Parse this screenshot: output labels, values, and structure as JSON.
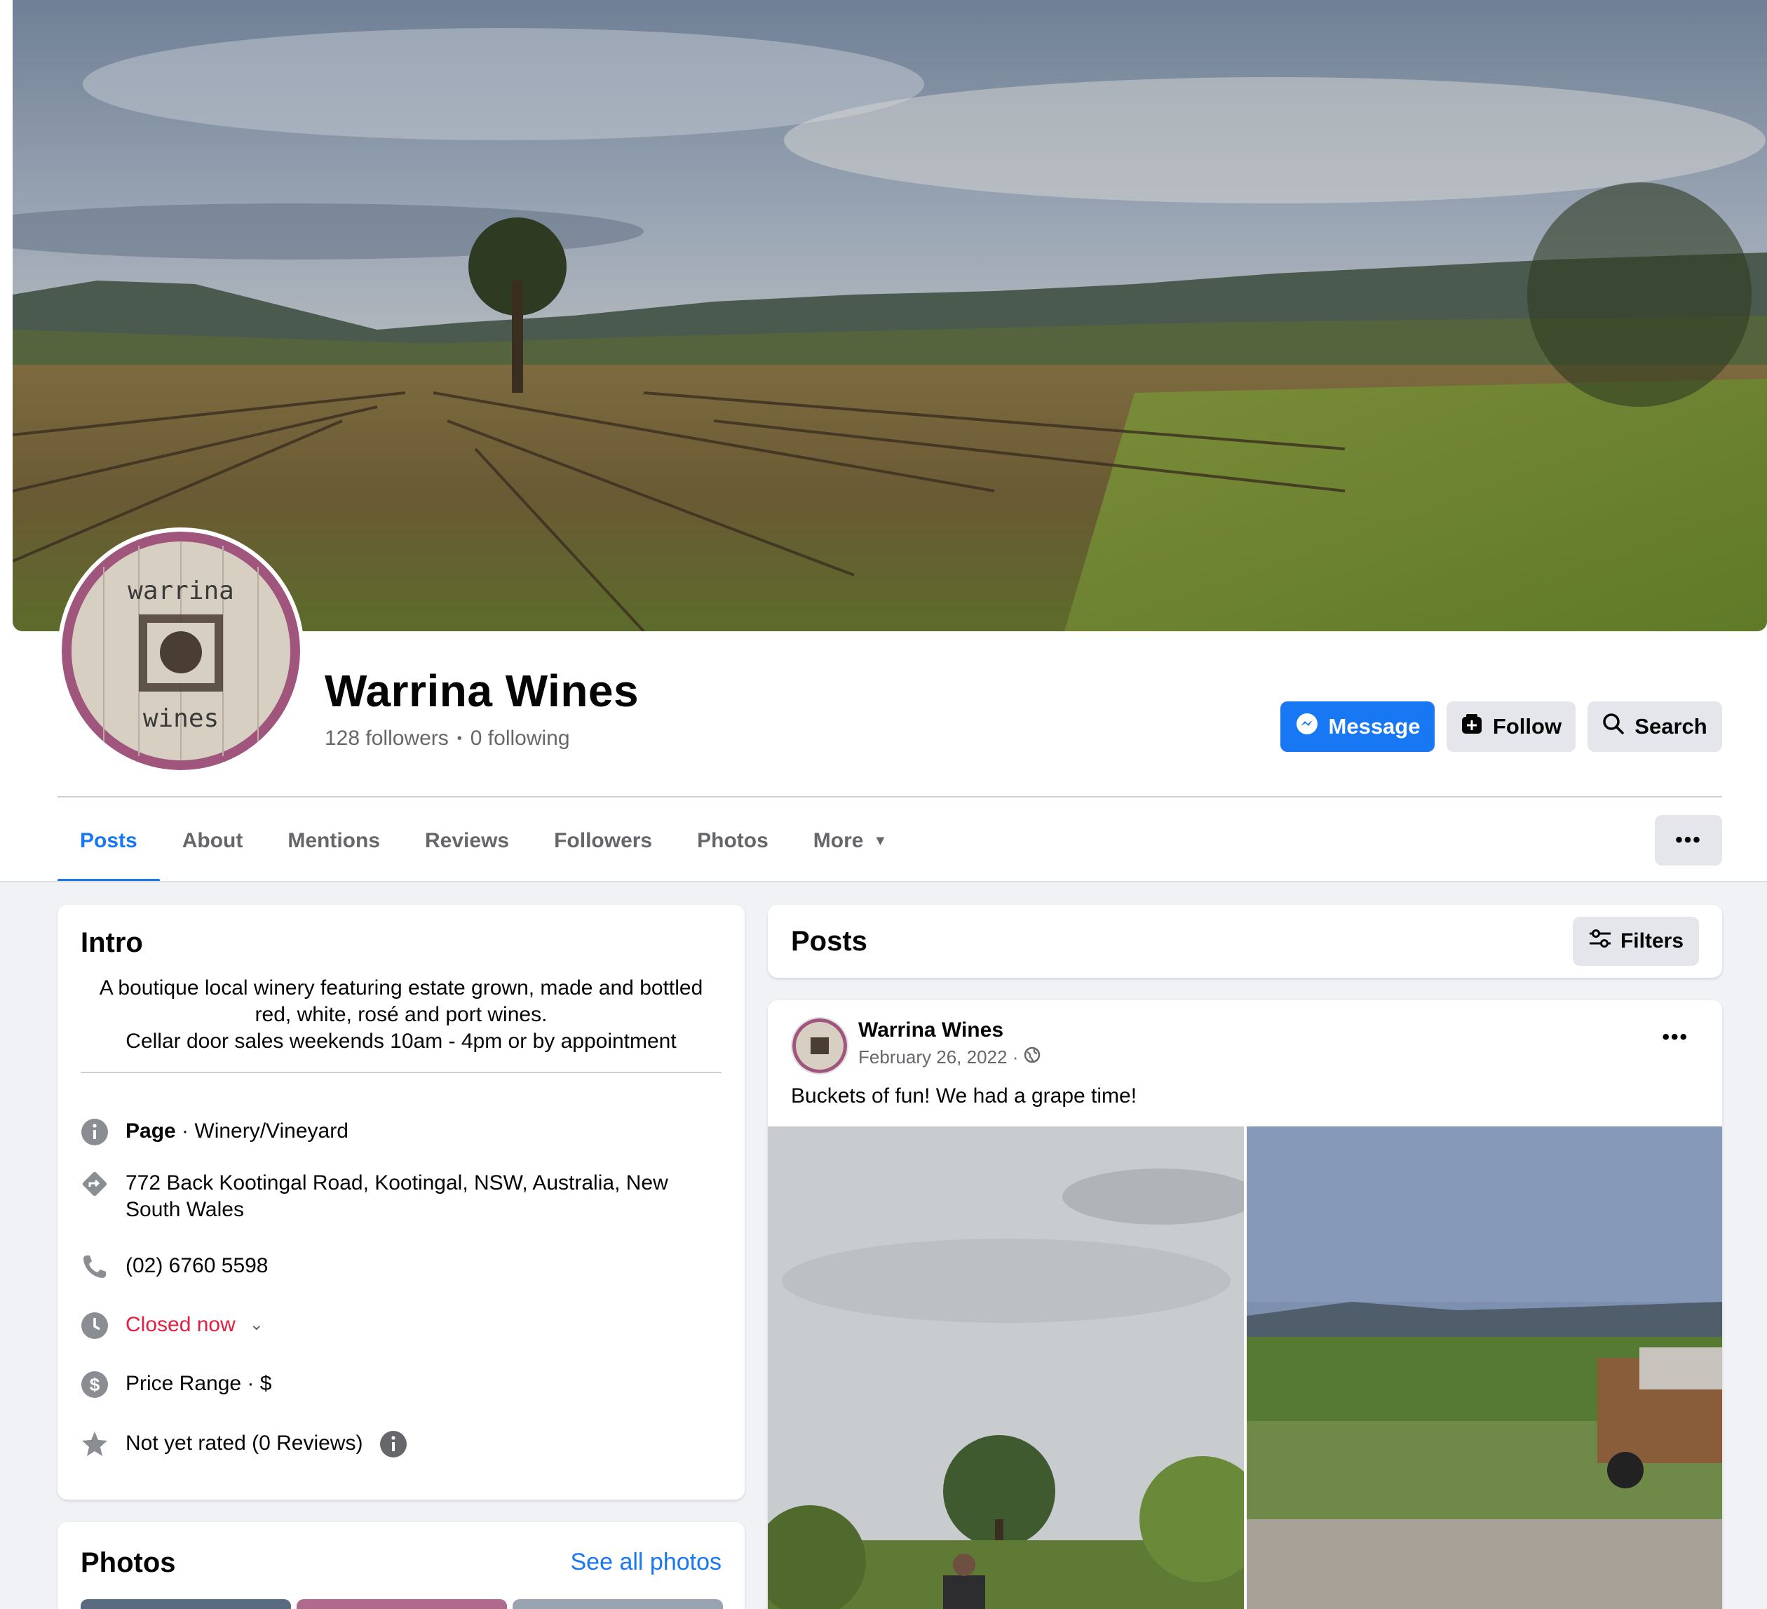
{
  "page": {
    "name": "Warrina Wines",
    "followers": "128 followers",
    "separator": "•",
    "following": "0 following"
  },
  "avatar": {
    "logo_text_top": "warrina",
    "logo_text_bottom": "wines"
  },
  "actions": {
    "message": "Message",
    "follow": "Follow",
    "search": "Search"
  },
  "tabs": [
    {
      "label": "Posts",
      "active": true
    },
    {
      "label": "About"
    },
    {
      "label": "Mentions"
    },
    {
      "label": "Reviews"
    },
    {
      "label": "Followers"
    },
    {
      "label": "Photos"
    },
    {
      "label": "More"
    }
  ],
  "more_menu_icon": "more-dots",
  "intro": {
    "title": "Intro",
    "bio_line1": "A boutique local winery featuring estate grown, made and bottled",
    "bio_line2": "red, white, rosé and port wines.",
    "bio_line3": "Cellar door sales weekends 10am - 4pm or by appointment",
    "category_label": "Page",
    "category_value": " · Winery/Vineyard",
    "address_line1": "772 Back Kootingal Road, Kootingal, NSW, Australia, New",
    "address_line2": "South Wales",
    "phone": "(02) 6760 5598",
    "hours_status": "Closed now",
    "price_range": "Price Range · $",
    "rating": "Not yet rated (0 Reviews)"
  },
  "photos": {
    "title": "Photos",
    "see_all": "See all photos"
  },
  "posts": {
    "title": "Posts",
    "filters": "Filters"
  },
  "post": {
    "author": "Warrina Wines",
    "date": "February 26, 2022 ·",
    "text": "Buckets of fun! We had a grape time!"
  },
  "colors": {
    "accent": "#1877f2",
    "closed": "#e41e3f",
    "muted": "#65676b",
    "button_gray": "#e4e6eb"
  }
}
